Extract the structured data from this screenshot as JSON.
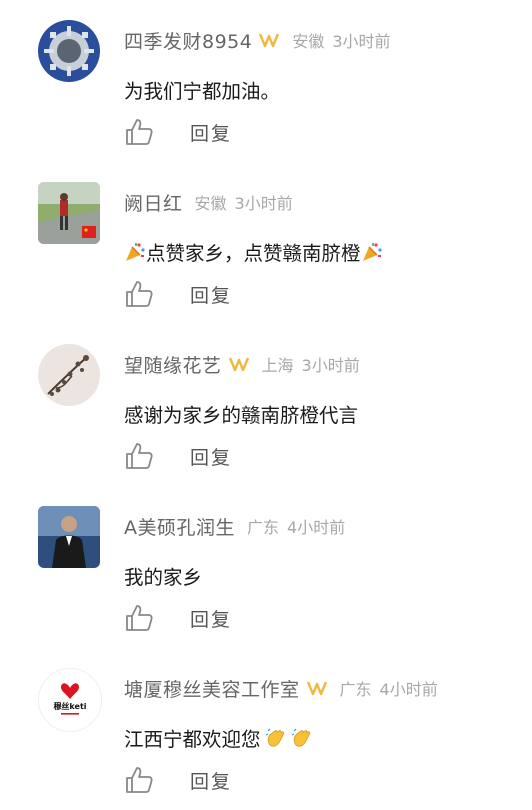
{
  "comments": [
    {
      "user": "四季发财8954",
      "vip": true,
      "location": "安徽",
      "time": "3小时前",
      "text": "为我们宁都加油。",
      "emojis": [],
      "reply": "回复",
      "avatar": "avatar-icon"
    },
    {
      "user": "阙日红",
      "vip": false,
      "location": "安徽",
      "time": "3小时前",
      "text_parts": [
        "点赞家乡，点赞赣南脐橙"
      ],
      "emojis": [
        "party-popper-icon",
        "party-popper-icon"
      ],
      "reply": "回复",
      "avatar": "avatar-icon"
    },
    {
      "user": "望随缘花艺",
      "vip": true,
      "location": "上海",
      "time": "3小时前",
      "text": "感谢为家乡的赣南脐橙代言",
      "emojis": [],
      "reply": "回复",
      "avatar": "avatar-icon"
    },
    {
      "user": "A美硕孔润生",
      "vip": false,
      "location": "广东",
      "time": "4小时前",
      "text": "我的家乡",
      "emojis": [],
      "reply": "回复",
      "avatar": "avatar-icon"
    },
    {
      "user": "塘厦穆丝美容工作室",
      "vip": true,
      "location": "广东",
      "time": "4小时前",
      "text": "江西宁都欢迎您",
      "emojis": [
        "clapping-hands-icon",
        "clapping-hands-icon"
      ],
      "reply": "回复",
      "avatar": "avatar-icon",
      "avatar_logo_text": "穆丝keti"
    }
  ],
  "colors": {
    "vip": "#f0b840",
    "like": "#888888",
    "meta": "#a8a8a8"
  }
}
